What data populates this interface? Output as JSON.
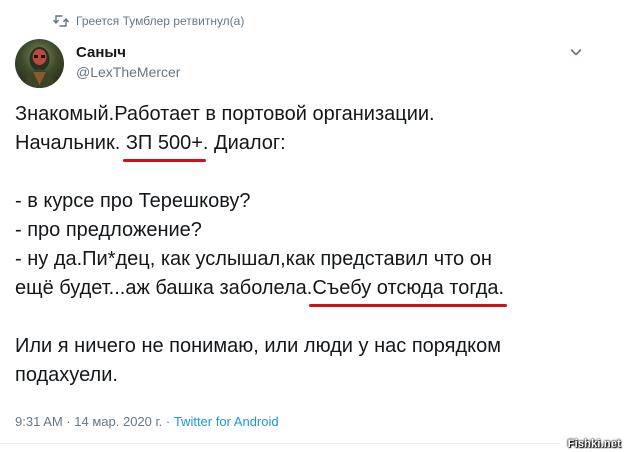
{
  "retweet": {
    "text": "Греется Тумблер ретвитнул(а)",
    "icon": "retweet-icon"
  },
  "author": {
    "name": "Саныч",
    "handle": "@LexTheMercer",
    "avatar_icon": "avatar-image"
  },
  "menu_icon": "chevron-down-icon",
  "tweet": {
    "line1": "Знакомый.Работает в портовой организации.",
    "line2_pre": "Начальник. ",
    "line2_mark": "ЗП 500+",
    "line2_post": ". Диалог:",
    "line3": "- в курсе про Терешкову?",
    "line4": "- про предложение?",
    "line5": "- ну да.Пи*дец, как услышал,как представил что он",
    "line6_pre": "ещё будет...аж башка заболела.",
    "line6_mark": "Съебу отсюда тогда.",
    "line7": "Или я ничего не понимаю, или люди у нас порядком",
    "line8": "подахуели."
  },
  "meta": {
    "time": "9:31 AM",
    "sep1": " · ",
    "date": "14 мар. 2020 г.",
    "sep2": " · ",
    "source": "Twitter for Android"
  },
  "watermark": "Fishki.net",
  "colors": {
    "underline": "#d40e14",
    "link": "#1b95e0",
    "secondary": "#657786"
  }
}
